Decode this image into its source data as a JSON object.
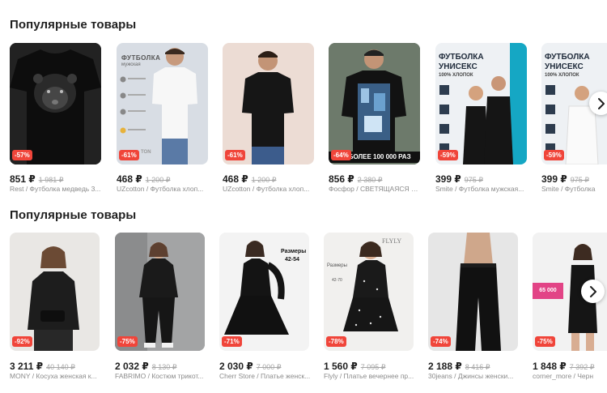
{
  "sections": [
    {
      "title": "Популярные товары",
      "products": [
        {
          "price": "851 ₽",
          "old_price": "1 981 ₽",
          "discount": "-57%",
          "desc": "Rest / Футболка медведь 3..."
        },
        {
          "price": "468 ₽",
          "old_price": "1 200 ₽",
          "discount": "-61%",
          "desc": "UZcotton / Футболка хлоп...",
          "poster": {
            "title": "ФУТБОЛКА",
            "subtitle": "мужская",
            "brand": "TON"
          }
        },
        {
          "price": "468 ₽",
          "old_price": "1 200 ₽",
          "discount": "-61%",
          "desc": "UZcotton / Футболка хлоп..."
        },
        {
          "price": "856 ₽",
          "old_price": "2 380 ₽",
          "discount": "-64%",
          "desc": "Фосфор / СВЕТЯЩАЯСЯ Ф...",
          "poster": {
            "banner": "НЕ БОЛЕЕ 100 000 РАЗ"
          }
        },
        {
          "price": "399 ₽",
          "old_price": "975 ₽",
          "discount": "-59%",
          "desc": "Smite / Футболка мужская...",
          "poster": {
            "title1": "ФУТБОЛКА",
            "title2": "УНИСЕКС",
            "subtitle": "100% ХЛОПОК"
          }
        },
        {
          "price": "399 ₽",
          "old_price": "975 ₽",
          "discount": "-59%",
          "desc": "Smite / Футболка",
          "poster": {
            "title1": "ФУТБОЛКА",
            "title2": "УНИСЕКС",
            "subtitle": "100% ХЛОПОК"
          }
        }
      ]
    },
    {
      "title": "Популярные товары",
      "products": [
        {
          "price": "3 211 ₽",
          "old_price": "40 140 ₽",
          "discount": "-92%",
          "desc": "MONY / Косуха женская к..."
        },
        {
          "price": "2 032 ₽",
          "old_price": "8 130 ₽",
          "discount": "-75%",
          "desc": "FABRIMO / Костюм трикот..."
        },
        {
          "price": "2 030 ₽",
          "old_price": "7 000 ₽",
          "discount": "-71%",
          "desc": "Cherr Store / Платье женск...",
          "poster": {
            "sizes": "Размеры",
            "range": "42-54"
          }
        },
        {
          "price": "1 560 ₽",
          "old_price": "7 095 ₽",
          "discount": "-78%",
          "desc": "Flyly / Платье вечернее пр...",
          "poster": {
            "brand": "FLYLY",
            "sizes": "Размеры",
            "range": "42-70"
          }
        },
        {
          "price": "2 188 ₽",
          "old_price": "8 416 ₽",
          "discount": "-74%",
          "desc": "30jeans / Джинсы женски..."
        },
        {
          "price": "1 848 ₽",
          "old_price": "7 392 ₽",
          "discount": "-75%",
          "desc": "corner_more / Черн",
          "poster": {
            "count": "65 000"
          }
        }
      ]
    }
  ],
  "icons": {
    "next": "chevron-right-icon"
  }
}
